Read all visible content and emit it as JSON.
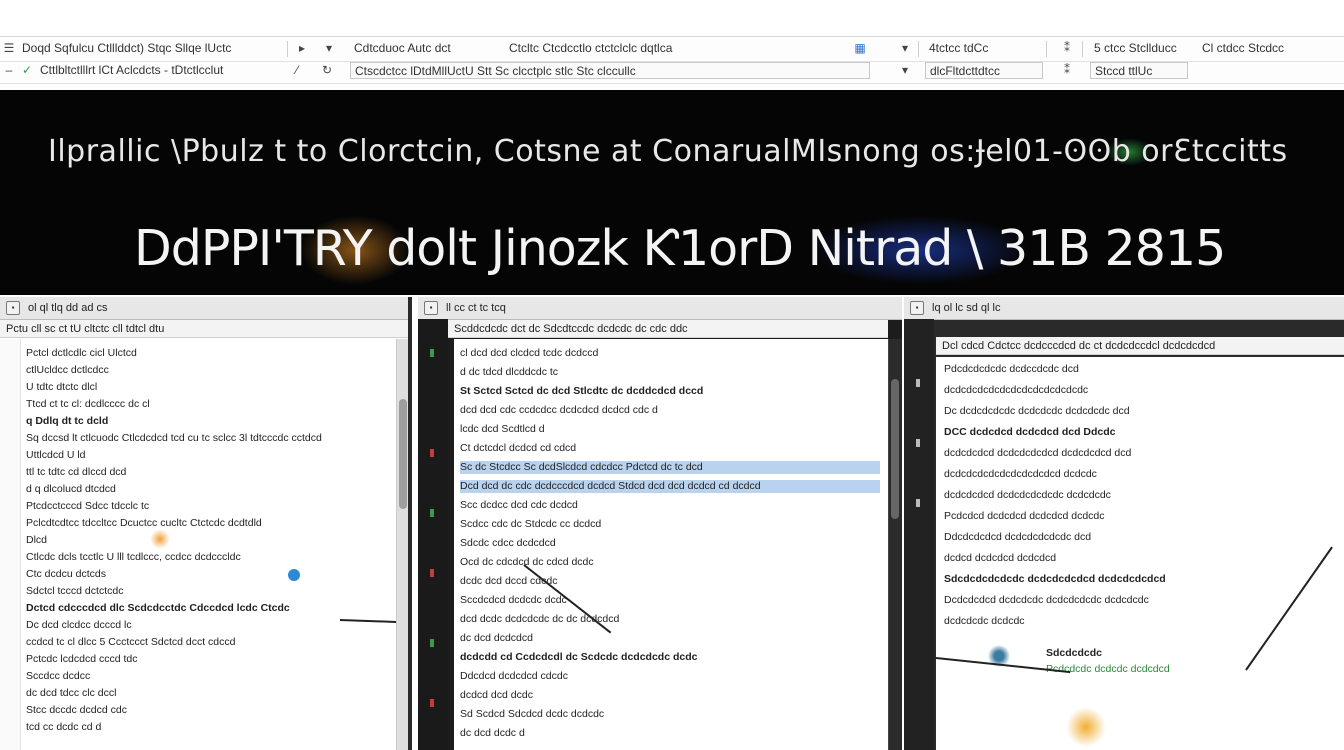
{
  "toolbar": {
    "row1": {
      "menu1": "Doqd Sqfulcu Ctlllddct) Stqc Sllqe lUctc",
      "field1": "Cdtcduoc Autc dct",
      "field2": "Ctcltc Ctcdcctlo ctctclclc dqtlca",
      "field3": "4tctcc tdCc",
      "field4": "5 ctcc Stcllducc",
      "field5": "Cl ctdcc Stcdcc"
    },
    "row2": {
      "menu1": "Cttlbltctlllrt lCt Aclcdcts - tDtctlcclut",
      "field1": "Ctscdctcc lDtdMllUctU Stt Sc clcctplc stlc Stc clccullc",
      "field2": "dlcFltdcttdtcc",
      "field3": "Stccd ttlUc"
    }
  },
  "banner": {
    "line1": "Ilprallic \\Pbulz t to Clorctcin, Cotsne at ConarualMIsnong os:Ɉel01-ʘʘb orƐtccitts",
    "line2": "DdPPI'TRY dolt Jinozk Ƙ1orD Nitrad \\ 31B 2815"
  },
  "panel1": {
    "title": "ol ql tlq dd ad cs",
    "menu": "Pctu cll sc ct tU cltctc cll tdtcl dtu",
    "lines": [
      "Pctcl dctlcdlc cicl Ulctcd",
      "ctlUcldcc dctlcdcc",
      "U tdtc dtctc dlcl",
      "Ttcd ct tc cl: dcdlcccc dc cl",
      "q Ddlq dt tc dcld",
      "Sq dccsd lt ctlcuodc Ctlcdcdcd tcd cu tc sclcc 3l tdtcccdc cctdcd",
      "Uttlcdcd U ld",
      "ttl tc tdtc cd dlccd dcd",
      "d q dlcolucd dtcdcd",
      "Ptcdcctcccd Sdcc tdcclc tc",
      "Pclcdtcdtcc tdccltcc Dcuctcc cucltc Ctctcdc dcdtdld",
      "Dlcd",
      "Ctlcdc dcls tcctlc U lll tcdlccc, ccdcc dcdcccldc",
      "Ctc dcdcu dctcds",
      "Sdctcl tcccd dctctcdc",
      "Dctcd cdcccdcd dlc Scdcdcctdc Cdccdcd lcdc Ctcdc",
      "Dc dcd clcdcc dcccd lc",
      "ccdcd tc cl dlcc 5 Ccctccct Sdctcd dcct cdccd",
      "Pctcdc lcdcdcd cccd tdc",
      "Sccdcc dcdcc",
      "dc dcd tdcc clc dccl",
      "Stcc dccdc dcdcd cdc",
      "tcd cc dcdc cd d"
    ]
  },
  "panel2": {
    "title": "ll cc ct tc tcq",
    "menu": "Scddcdcdc dct dc Sdcdtccdc dcdcdc dc cdc ddc",
    "lines": [
      "cl dcd dcd clcdcd tcdc dcdccd",
      "d dc tdcd dlcddcdc tc",
      "St Sctcd Sctcd dc dcd Stlcdtc dc dcddcdcd dccd",
      "dcd dcd cdc ccdcdcc dcdcdcd dcdcd cdc d",
      "lcdc dcd Scdtlcd d",
      "Ct dctcdcl dcdcd cd cdcd",
      "Sc dc Stcdcc Sc dcdSlcdcd cdcdcc   Pdctcd dc tc dcd",
      "Dcd dcd dc cdc dcdcccdcd dcdcd   Stdcd dcd dcd dcdcd cd dcdcd",
      "Scc dcdcc dcd cdc dcdcd",
      "Scdcc cdc dc Stdcdc cc dcdcd",
      "Sdcdc cdcc dcdcdcd",
      "Ocd dc cdcdcd dc cdcd dcdc",
      "dcdc dcd dccd cdcdc",
      "Sccdcdcd dcdcdc dcdc",
      "dcd dcdc dcdcdcdc dc dc dcdcdcd",
      "dc dcd dcdcdcd",
      "dcdcdd cd Ccdcdcdl dc Scdcdc dcdcdcdc dcdc",
      "Ddcdcd dcdcdcd cdcdc",
      "dcdcd dcd dcdc",
      "Sd Scdcd Sdcdcd dcdc dcdcdc",
      "dc dcd dcdc d"
    ]
  },
  "panel3": {
    "title": "lq ol lc sd ql lc",
    "menu": "Dcl cdcd Cdctcc dcdcccdcd dc ct dcdcdccdcl dcdcdcdcd",
    "lines": [
      "Pdcdcdcdcdc dcdccdcdc dcd",
      "dcdcdcdcdcdcdcdcdcdcdcdcdc",
      "Dc dcdcdcdcdc dcdcdcdc dcdcdcdc dcd",
      "DCC dcdcdcd dcdcdcd dcd Ddcdc",
      "dcdcdcdcd dcdcdcdcdcd dcdcdcdcd dcd",
      "dcdcdcdcdcdcdcdcdcdcd dcdcdc",
      "dcdcdcdcd dcdcdcdcdcdc dcdcdcdc",
      "Pcdcdcd dcdcdcd dcdcdcd dcdcdc",
      "Ddcdcdcdcd dcdcdcdcdcdc dcd",
      "dcdcd dcdcdcd dcdcdcd",
      "Sdcdcdcdcdcdc dcdcdcdcdcd dcdcdcdcdcd",
      "Dcdcdcdcd dcdcdcdc dcdcdcdcdc dcdcdcdc",
      "dcdcdcdc dcdcdc"
    ],
    "badge": "Sdcdcdcdc",
    "badge_sub": "Pcdcdcdc dcdcdc dcdcdcd"
  },
  "colors": {
    "banner_bg": "#050505",
    "banner_text": "#f0f0f0",
    "highlight": "#b9d3ef",
    "accent_orange": "#f0962a",
    "accent_blue": "#2a6fd0",
    "accent_green": "#2a9a4a"
  }
}
